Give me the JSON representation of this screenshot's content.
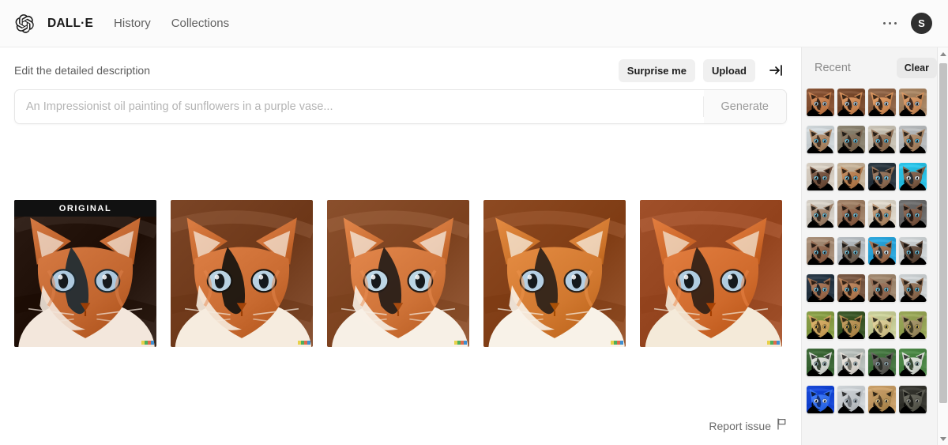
{
  "header": {
    "logo_icon": "openai-logo-icon",
    "brand": "DALL·E",
    "nav": [
      {
        "label": "History"
      },
      {
        "label": "Collections"
      }
    ],
    "more_icon": "ellipsis-icon",
    "avatar_initial": "S"
  },
  "toolbar": {
    "title": "Edit the detailed description",
    "surprise_label": "Surprise me",
    "upload_label": "Upload",
    "collapse_icon": "collapse-right-icon"
  },
  "prompt": {
    "value": "",
    "placeholder": "An Impressionist oil painting of sunflowers in a purple vase...",
    "generate_label": "Generate",
    "generate_disabled": true
  },
  "results": {
    "original_badge": "ORIGINAL",
    "items": [
      {
        "id": "result-1",
        "is_original": true,
        "bg": "#2a1a12",
        "fur": "#c2662f",
        "light": "#f3e7dc",
        "dark": "#1d2b33",
        "eye": "#aec9de"
      },
      {
        "id": "result-2",
        "is_original": false,
        "bg": "#7b4526",
        "fur": "#c96b31",
        "light": "#f6ecdf",
        "dark": "#16130f",
        "eye": "#b9d2e2"
      },
      {
        "id": "result-3",
        "is_original": false,
        "bg": "#8a4f2c",
        "fur": "#cf7338",
        "light": "#f7f0e6",
        "dark": "#241c18",
        "eye": "#bcd6e6"
      },
      {
        "id": "result-4",
        "is_original": false,
        "bg": "#8d4a22",
        "fur": "#d1782f",
        "light": "#f8f2e8",
        "dark": "#2b2119",
        "eye": "#b5cfe3"
      },
      {
        "id": "result-5",
        "is_original": false,
        "bg": "#a0502a",
        "fur": "#cf6a2c",
        "light": "#f4ead9",
        "dark": "#301f16",
        "eye": "#b0cce0"
      }
    ],
    "watermark_colors": [
      "#e8d14a",
      "#4fae5a",
      "#e06a4a",
      "#3f8fd0"
    ]
  },
  "report": {
    "label": "Report issue",
    "icon": "flag-icon"
  },
  "sidebar": {
    "title": "Recent",
    "clear_label": "Clear",
    "rows": [
      {
        "id": "row-1",
        "thumbs": [
          {
            "bg": "#8a5638",
            "fur": "#c07a4a",
            "dark": "#2a1b12",
            "eye": "#9fb8c6"
          },
          {
            "bg": "#7e5034",
            "fur": "#c98552",
            "dark": "#241610",
            "eye": "#a8c2d2"
          },
          {
            "bg": "#91674a",
            "fur": "#cf8b55",
            "dark": "#2e1d14",
            "eye": "#b2c8d6"
          },
          {
            "bg": "#a98766",
            "fur": "#c98a58",
            "dark": "#32211a",
            "eye": "#9cb4c4"
          }
        ]
      },
      {
        "id": "row-2",
        "thumbs": [
          {
            "bg": "#cfd6d9",
            "fur": "#a88463",
            "dark": "#3b2a20",
            "eye": "#57b6d8"
          },
          {
            "bg": "#8e8674",
            "fur": "#7d6a55",
            "dark": "#2d241c",
            "eye": "#64c0de"
          },
          {
            "bg": "#c9c3b6",
            "fur": "#8e7056",
            "dark": "#342620",
            "eye": "#5cbcdc"
          },
          {
            "bg": "#b9bcbe",
            "fur": "#a58262",
            "dark": "#3a2a20",
            "eye": "#4fb3d6"
          }
        ]
      },
      {
        "id": "row-3",
        "thumbs": [
          {
            "bg": "#d8cfc3",
            "fur": "#6f4e3b",
            "dark": "#241711",
            "eye": "#6fc3de"
          },
          {
            "bg": "#c6b39a",
            "fur": "#b0794c",
            "dark": "#2c1c14",
            "eye": "#63bcd9"
          },
          {
            "bg": "#2f3b44",
            "fur": "#8a6a52",
            "dark": "#16202a",
            "eye": "#74c9e8"
          },
          {
            "bg": "#2fc4e8",
            "fur": "#7a5a44",
            "dark": "#1c2a34",
            "eye": "#e9f4f8"
          }
        ]
      },
      {
        "id": "row-4",
        "thumbs": [
          {
            "bg": "#d5cfc6",
            "fur": "#9c7f68",
            "dark": "#2e2219",
            "eye": "#5fbad8"
          },
          {
            "bg": "#a2836a",
            "fur": "#8a5f46",
            "dark": "#241811",
            "eye": "#6ec3dd"
          },
          {
            "bg": "#ddd6c9",
            "fur": "#b08a68",
            "dark": "#33241b",
            "eye": "#5ab6d4"
          },
          {
            "bg": "#6f6f6f",
            "fur": "#7a5743",
            "dark": "#201612",
            "eye": "#68bedb"
          }
        ]
      },
      {
        "id": "row-5",
        "thumbs": [
          {
            "bg": "#a9907a",
            "fur": "#8a6048",
            "dark": "#241a13",
            "eye": "#62b8d6"
          },
          {
            "bg": "#b9bfc4",
            "fur": "#6e6155",
            "dark": "#241e19",
            "eye": "#6cc2dc"
          },
          {
            "bg": "#2fa8dd",
            "fur": "#9a6c4e",
            "dark": "#1d2a33",
            "eye": "#ddeef6"
          },
          {
            "bg": "#cfd4d6",
            "fur": "#5f4a3c",
            "dark": "#1a1410",
            "eye": "#63bcda"
          }
        ]
      },
      {
        "id": "row-6",
        "thumbs": [
          {
            "bg": "#2b3a48",
            "fur": "#9a6a4c",
            "dark": "#141d26",
            "eye": "#6ec5e4"
          },
          {
            "bg": "#7a5a46",
            "fur": "#b07a52",
            "dark": "#241810",
            "eye": "#59b6d6"
          },
          {
            "bg": "#a28a72",
            "fur": "#8f6850",
            "dark": "#261a13",
            "eye": "#6ac0dc"
          },
          {
            "bg": "#cdd2d4",
            "fur": "#8a6a50",
            "dark": "#241a14",
            "eye": "#5ab8d8"
          }
        ]
      },
      {
        "id": "row-7",
        "thumbs": [
          {
            "bg": "#8aa04a",
            "fur": "#c9a05a",
            "dark": "#4a3a20",
            "eye": "#caa44e"
          },
          {
            "bg": "#3f5a2c",
            "fur": "#b08a4e",
            "dark": "#28321c",
            "eye": "#c6a04a"
          },
          {
            "bg": "#c9cf9a",
            "fur": "#cfc08a",
            "dark": "#6a6040",
            "eye": "#b8a84e"
          },
          {
            "bg": "#9aa85a",
            "fur": "#9a8a60",
            "dark": "#3c3a24",
            "eye": "#c0a850"
          }
        ]
      },
      {
        "id": "row-8",
        "thumbs": [
          {
            "bg": "#3f6a3a",
            "fur": "#cfd2cd",
            "dark": "#2a3a28",
            "eye": "#8aa0a8"
          },
          {
            "bg": "#b9c0bc",
            "fur": "#d6d2cb",
            "dark": "#6a6a62",
            "eye": "#96aab0"
          },
          {
            "bg": "#4a7a46",
            "fur": "#5a5a54",
            "dark": "#262a24",
            "eye": "#8ea4aa"
          },
          {
            "bg": "#4f8a4a",
            "fur": "#cfd4cd",
            "dark": "#2e4029",
            "eye": "#90a6ac"
          }
        ]
      },
      {
        "id": "row-9",
        "thumbs": [
          {
            "bg": "#1a4ad8",
            "fur": "#2f6ae8",
            "dark": "#122a6a",
            "eye": "#dce8f8"
          },
          {
            "bg": "#cfd4d8",
            "fur": "#b9bec2",
            "dark": "#6a6f74",
            "eye": "#9aa8b2"
          },
          {
            "bg": "#c9a06a",
            "fur": "#b08a52",
            "dark": "#4a3a24",
            "eye": "#d6b87a"
          },
          {
            "bg": "#3a3a34",
            "fur": "#5a5a50",
            "dark": "#1e1e1a",
            "eye": "#8a8a80"
          }
        ]
      }
    ],
    "scrollbar": {
      "up_icon": "scroll-up-arrow-icon",
      "down_icon": "scroll-down-arrow-icon"
    }
  }
}
